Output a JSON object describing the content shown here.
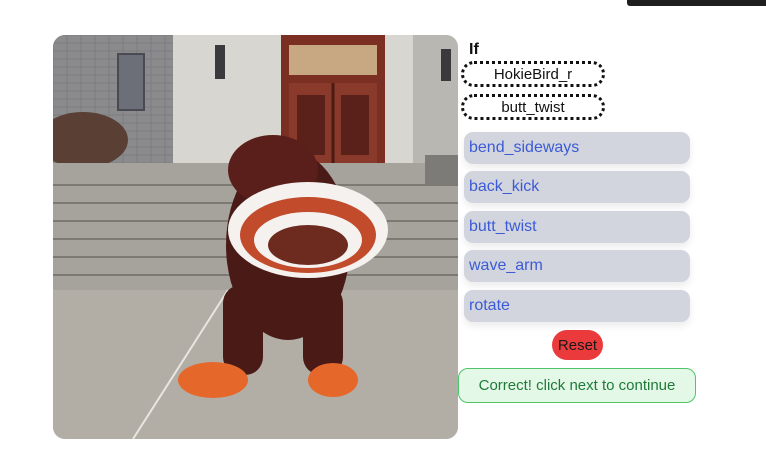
{
  "puzzle": {
    "if_label": "If",
    "slots": [
      "HokieBird_r",
      "butt_twist"
    ],
    "options": [
      "bend_sideways",
      "back_kick",
      "butt_twist",
      "wave_arm",
      "rotate"
    ],
    "reset_label": "Reset",
    "status_message": "Correct! click next to continue"
  }
}
